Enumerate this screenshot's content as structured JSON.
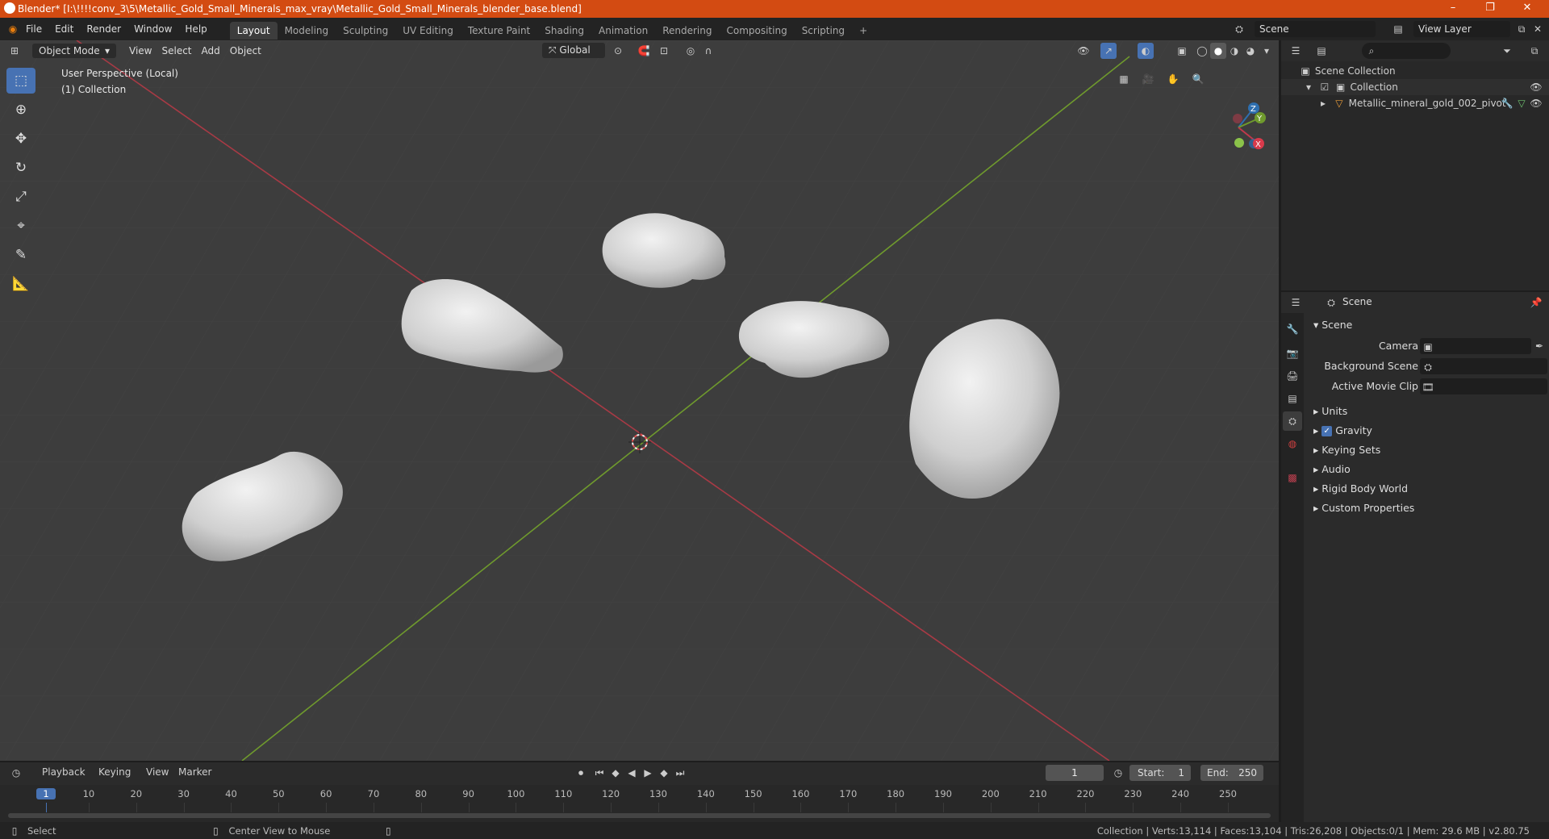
{
  "window": {
    "title": "Blender* [I:\\!!!!conv_3\\5\\Metallic_Gold_Small_Minerals_max_vray\\Metallic_Gold_Small_Minerals_blender_base.blend]",
    "minimize": "–",
    "maximize": "❐",
    "close": "✕"
  },
  "menu": [
    "File",
    "Edit",
    "Render",
    "Window",
    "Help"
  ],
  "workspaces": [
    "Layout",
    "Modeling",
    "Sculpting",
    "UV Editing",
    "Texture Paint",
    "Shading",
    "Animation",
    "Rendering",
    "Compositing",
    "Scripting"
  ],
  "workspace_add": "+",
  "scene_field": "Scene",
  "view_layer_field": "View Layer",
  "viewport": {
    "mode": "Object Mode",
    "menus": [
      "View",
      "Select",
      "Add",
      "Object"
    ],
    "orientation": "Global",
    "perspective_label": "User Perspective (Local)",
    "collection_label": "(1) Collection",
    "gizmo_axes": {
      "x": "X",
      "y": "Y",
      "z": "Z"
    }
  },
  "outliner": {
    "root": "Scene Collection",
    "collection": "Collection",
    "object": "Metallic_mineral_gold_002_pivot"
  },
  "properties": {
    "header": "Scene",
    "section": "Scene",
    "fields": [
      {
        "label": "Camera",
        "value": ""
      },
      {
        "label": "Background Scene",
        "value": ""
      },
      {
        "label": "Active Movie Clip",
        "value": ""
      }
    ],
    "subsections": [
      "Units",
      "Gravity",
      "Keying Sets",
      "Audio",
      "Rigid Body World",
      "Custom Properties"
    ],
    "gravity_checked": true
  },
  "timeline": {
    "menus": [
      "Playback",
      "Keying",
      "View",
      "Marker"
    ],
    "current_frame": "1",
    "start_label": "Start:",
    "start": "1",
    "end_label": "End:",
    "end": "250",
    "ticks": [
      "1",
      "10",
      "20",
      "30",
      "40",
      "50",
      "60",
      "70",
      "80",
      "90",
      "100",
      "110",
      "120",
      "130",
      "140",
      "150",
      "160",
      "170",
      "180",
      "190",
      "200",
      "210",
      "220",
      "230",
      "240",
      "250"
    ]
  },
  "status": {
    "left_action": "Select",
    "mid_action": "Center View to Mouse",
    "stats": "Collection | Verts:13,114 | Faces:13,104 | Tris:26,208 | Objects:0/1 | Mem: 29.6 MB | v2.80.75"
  },
  "colors": {
    "titlebar": "#d34b12",
    "viewport_bg": "#3d3d3d",
    "x_axis": "#a83a45",
    "y_axis": "#6f9a2d",
    "active_tool": "#4772b3"
  }
}
